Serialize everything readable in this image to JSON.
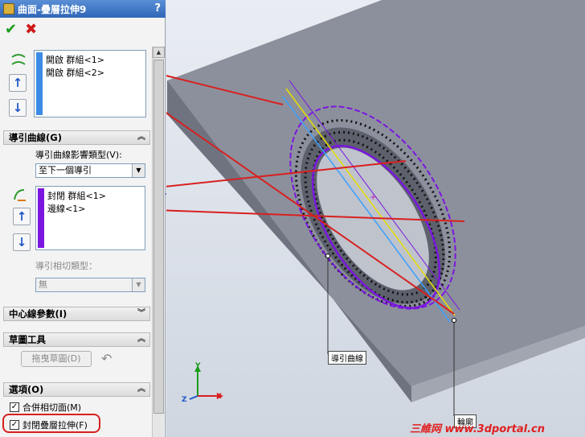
{
  "window": {
    "title": "曲面-疊層拉伸9",
    "help": "?"
  },
  "toolbar": {
    "ok_icon": "checkmark-icon",
    "cancel_icon": "x-icon"
  },
  "profiles": {
    "items": [
      "開啟 群組<1>",
      "開啟 群組<2>"
    ]
  },
  "guides": {
    "header": "導引曲線(G)",
    "influence_label": "導引曲線影響類型(V):",
    "influence_value": "至下一個導引",
    "items": [
      "封閉 群組<1>",
      "邊線<1>"
    ],
    "tangency_label": "導引相切類型：",
    "tangency_value": "無"
  },
  "centerline": {
    "header": "中心線參數(I)"
  },
  "sketch_tools": {
    "header": "草圖工具",
    "drag_button": "拖曳草圖(D)"
  },
  "options": {
    "header": "選項(O)",
    "merge_tangent": "合併相切面(M)",
    "closed_loft": "封閉疊層拉伸(F)"
  },
  "viewport": {
    "callout_guide": "導引曲線",
    "callout_profile": "輪廓",
    "triad": {
      "x": "X",
      "y": "Y",
      "z": "Z"
    }
  },
  "colors": {
    "profile_stripe": "#3c8be6",
    "guide_stripe": "#7a16e0",
    "callout_line": "#d82020"
  },
  "watermark": "三維网 www.3dportal.cn"
}
